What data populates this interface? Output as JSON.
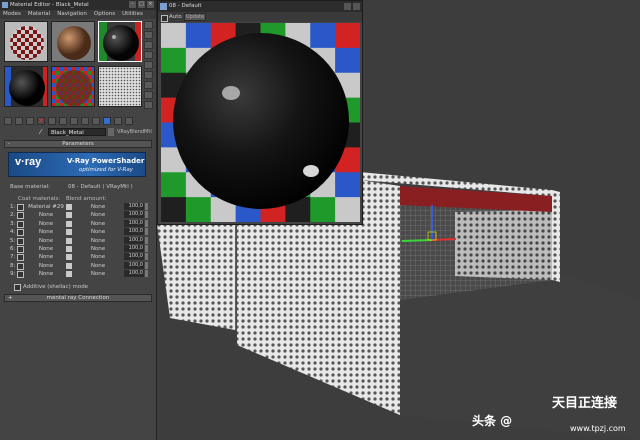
{
  "material_editor": {
    "title": "Material Editor - Black_Metal",
    "menu": [
      "Modes",
      "Material",
      "Navigation",
      "Options",
      "Utilities"
    ],
    "material_name": "Black_Metal",
    "material_type": "VRayBlendMtl",
    "parameters_rollout": "Parameters",
    "banner": {
      "logo": "v·ray",
      "title": "V-Ray PowerShader",
      "subtitle": "optimized for V-Ray"
    },
    "base_material_label": "Base material:",
    "base_material_value": "08 - Default  ( VRayMtl )",
    "coat_header": "Coat materials:",
    "blend_header": "Blend amount:",
    "rows": [
      {
        "num": "1:",
        "coat": "Material #29",
        "blend": "None",
        "amount": "100,0"
      },
      {
        "num": "2:",
        "coat": "None",
        "blend": "None",
        "amount": "100,0"
      },
      {
        "num": "3:",
        "coat": "None",
        "blend": "None",
        "amount": "100,0"
      },
      {
        "num": "4:",
        "coat": "None",
        "blend": "None",
        "amount": "100,0"
      },
      {
        "num": "5:",
        "coat": "None",
        "blend": "None",
        "amount": "100,0"
      },
      {
        "num": "6:",
        "coat": "None",
        "blend": "None",
        "amount": "100,0"
      },
      {
        "num": "7:",
        "coat": "None",
        "blend": "None",
        "amount": "100,0"
      },
      {
        "num": "8:",
        "coat": "None",
        "blend": "None",
        "amount": "100,0"
      },
      {
        "num": "9:",
        "coat": "None",
        "blend": "None",
        "amount": "100,0"
      }
    ],
    "additive_label": "Additive (shellac) mode",
    "mental_ray_rollout": "mental ray Connection"
  },
  "preview_window": {
    "title": "08 - Default",
    "auto_label": "Auto",
    "update_label": "Update"
  },
  "watermark": {
    "source": "头条 @",
    "brand": "天目正连接",
    "url": "www.tpzj.com"
  }
}
